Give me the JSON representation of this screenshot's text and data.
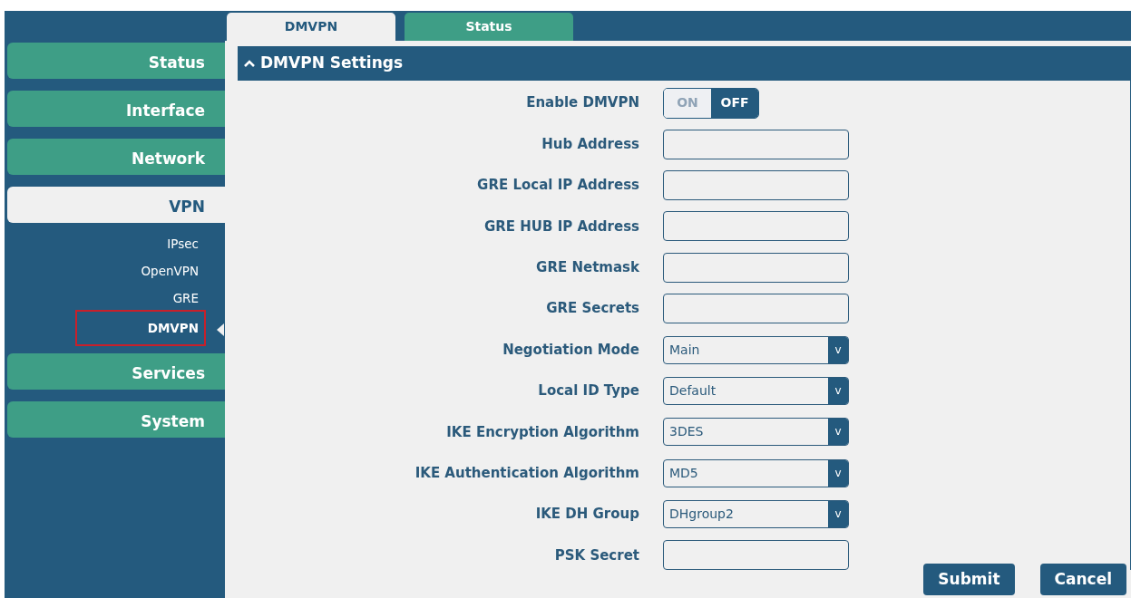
{
  "tabs": [
    {
      "label": "DMVPN",
      "selected": true
    },
    {
      "label": "Status",
      "selected": false
    }
  ],
  "sidebar": {
    "items": [
      {
        "label": "Status",
        "selected": false
      },
      {
        "label": "Interface",
        "selected": false
      },
      {
        "label": "Network",
        "selected": false
      },
      {
        "label": "VPN",
        "selected": true,
        "children": [
          {
            "label": "IPsec",
            "selected": false
          },
          {
            "label": "OpenVPN",
            "selected": false
          },
          {
            "label": "GRE",
            "selected": false
          },
          {
            "label": "DMVPN",
            "selected": true
          }
        ]
      },
      {
        "label": "Services",
        "selected": false
      },
      {
        "label": "System",
        "selected": false
      }
    ]
  },
  "panel": {
    "title": "DMVPN Settings",
    "expanded": true,
    "fields": [
      {
        "kind": "toggle",
        "label": "Enable DMVPN",
        "on_label": "ON",
        "off_label": "OFF",
        "on": false
      },
      {
        "kind": "text",
        "label": "Hub Address"
      },
      {
        "kind": "text",
        "label": "GRE Local IP Address"
      },
      {
        "kind": "text",
        "label": "GRE HUB IP Address"
      },
      {
        "kind": "text",
        "label": "GRE Netmask"
      },
      {
        "kind": "text",
        "label": "GRE Secrets"
      },
      {
        "kind": "select",
        "label": "Negotiation Mode",
        "value": "Main",
        "arrow": "v"
      },
      {
        "kind": "select",
        "label": "Local ID Type",
        "value": "Default",
        "arrow": "v"
      },
      {
        "kind": "select",
        "label": "IKE Encryption Algorithm",
        "value": "3DES",
        "arrow": "v"
      },
      {
        "kind": "select",
        "label": "IKE Authentication Algorithm",
        "value": "MD5",
        "arrow": "v"
      },
      {
        "kind": "select",
        "label": "IKE DH Group",
        "value": "DHgroup2",
        "arrow": "v"
      },
      {
        "kind": "text",
        "label": "PSK Secret"
      }
    ]
  },
  "buttons": [
    "Submit",
    "Cancel"
  ]
}
